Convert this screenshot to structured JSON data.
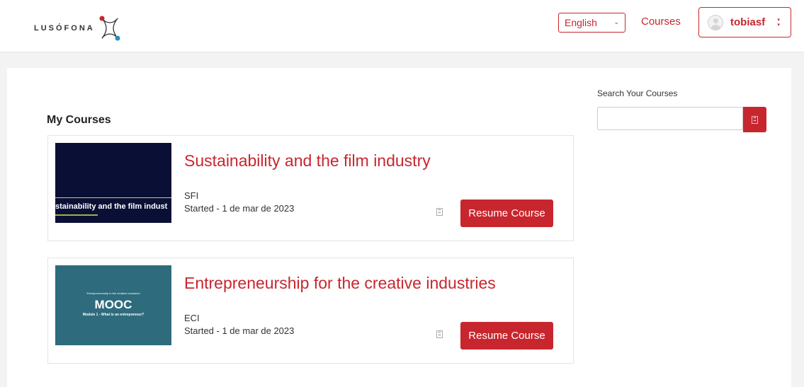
{
  "header": {
    "logo_text": "LUSÓFONA",
    "language": "English",
    "nav_courses": "Courses",
    "username": "tobiasf"
  },
  "main": {
    "title": "My Courses",
    "courses": [
      {
        "title": "Sustainability and the film industry",
        "code": "SFI",
        "started": "Started - 1 de mar de 2023",
        "button": "Resume Course",
        "thumb_text": "stainability and the film indust"
      },
      {
        "title": "Entrepreneurship for the creative industries",
        "code": "ECI",
        "started": "Started - 1 de mar de 2023",
        "button": "Resume Course",
        "thumb_sup": "Entrepreneurship in the creative industries",
        "thumb_main": "MOOC",
        "thumb_module": "Module 1 - What is an entrepreneur?"
      }
    ]
  },
  "sidebar": {
    "search_label": "Search Your Courses",
    "search_placeholder": ""
  },
  "colors": {
    "accent": "#c8262e",
    "thumb1_bg": "#0a0f35",
    "thumb2_bg": "#2e6b7c"
  },
  "icons": {
    "search_button": "search-icon",
    "user_menu": "chevron-down-icon",
    "date_marker": "calendar-icon"
  }
}
